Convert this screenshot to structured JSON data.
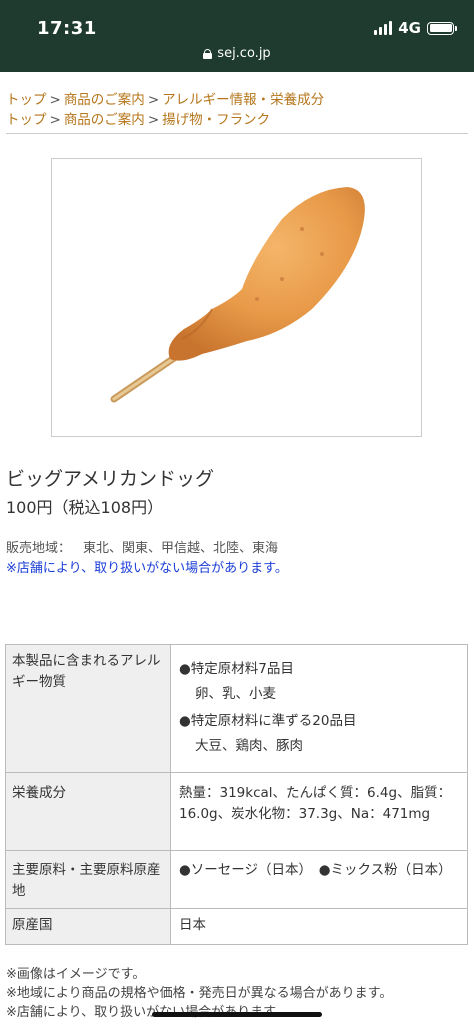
{
  "status": {
    "time": "17:31",
    "network": "4G",
    "url": "sej.co.jp"
  },
  "breadcrumbs": [
    {
      "items": [
        "トップ",
        "商品のご案内",
        "アレルギー情報・栄養成分"
      ],
      "separator": ">"
    },
    {
      "items": [
        "トップ",
        "商品のご案内",
        "揚げ物・フランク"
      ],
      "separator": ">"
    }
  ],
  "product": {
    "name": "ビッグアメリカンドッグ",
    "price": "100円（税込108円）",
    "image_alt": "corn-dog"
  },
  "sales": {
    "label": "販売地域：",
    "regions": "東北、関東、甲信越、北陸、東海",
    "note": "※店舗により、取り扱いがない場合があります。"
  },
  "table": {
    "allergen": {
      "header": "本製品に含まれるアレルギー物質",
      "specified_title": "●特定原材料7品目",
      "specified_items": "卵、乳、小麦",
      "equivalent_title": "●特定原材料に準ずる20品目",
      "equivalent_items": "大豆、鶏肉、豚肉"
    },
    "nutrition": {
      "header": "栄養成分",
      "value": "熱量：319kcal、たんぱく質：6.4g、脂質：16.0g、炭水化物：37.3g、Na：471mg"
    },
    "ingredients": {
      "header": "主要原料・主要原料原産地",
      "value": "●ソーセージ（日本）　●ミックス粉（日本）"
    },
    "origin": {
      "header": "原産国",
      "value": "日本"
    }
  },
  "notes": [
    "※画像はイメージです。",
    "※地域により商品の規格や価格・発売日が異なる場合があります。",
    "※店舗により、取り扱いがない場合があります。"
  ],
  "colors": {
    "status_bar": "#1f3a2e",
    "breadcrumb_link": "#b5761b",
    "note_blue": "#1a3dd6",
    "table_header_bg": "#efefef"
  }
}
